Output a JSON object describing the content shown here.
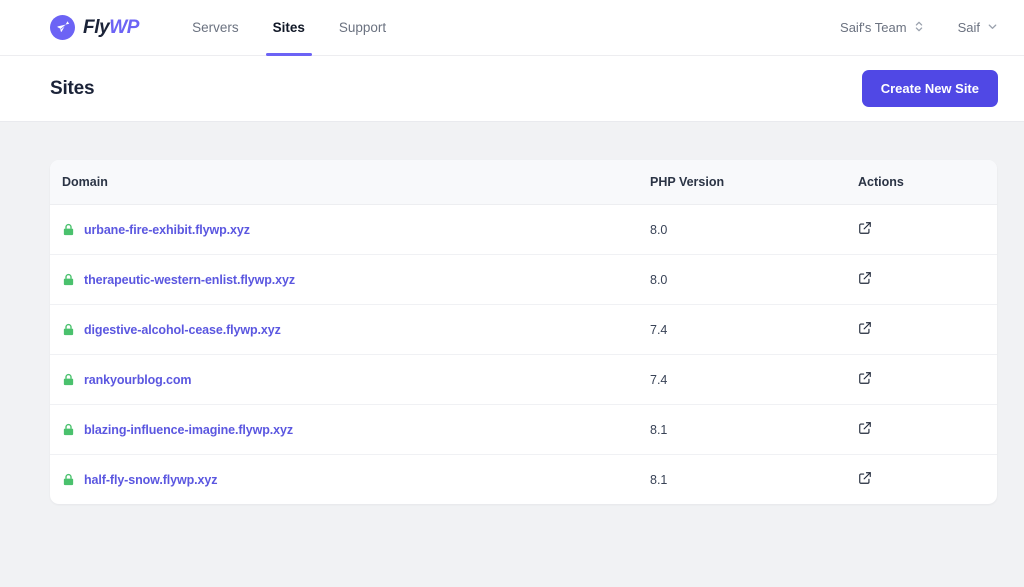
{
  "brand": {
    "name_part1": "Fly",
    "name_part2": "WP",
    "logo_icon": "paper-plane-icon",
    "accent_color": "#6c63f5"
  },
  "nav": {
    "items": [
      {
        "label": "Servers",
        "active": false
      },
      {
        "label": "Sites",
        "active": true
      },
      {
        "label": "Support",
        "active": false
      }
    ]
  },
  "account": {
    "team_label": "Saif's Team",
    "team_icon": "chevron-up-down-icon",
    "user_label": "Saif",
    "user_icon": "chevron-down-icon"
  },
  "header": {
    "title": "Sites",
    "create_button_label": "Create New Site",
    "create_button_color": "#5048e5"
  },
  "table": {
    "columns": [
      "Domain",
      "PHP Version",
      "Actions"
    ],
    "action_icon": "external-link-icon",
    "ssl_icon": "lock-icon",
    "ssl_icon_color": "#4ac16d",
    "link_color": "#5b57e0",
    "rows": [
      {
        "domain": "urbane-fire-exhibit.flywp.xyz",
        "php_version": "8.0",
        "secure": true
      },
      {
        "domain": "therapeutic-western-enlist.flywp.xyz",
        "php_version": "8.0",
        "secure": true
      },
      {
        "domain": "digestive-alcohol-cease.flywp.xyz",
        "php_version": "7.4",
        "secure": true
      },
      {
        "domain": "rankyourblog.com",
        "php_version": "7.4",
        "secure": true
      },
      {
        "domain": "blazing-influence-imagine.flywp.xyz",
        "php_version": "8.1",
        "secure": true
      },
      {
        "domain": "half-fly-snow.flywp.xyz",
        "php_version": "8.1",
        "secure": true
      }
    ]
  }
}
